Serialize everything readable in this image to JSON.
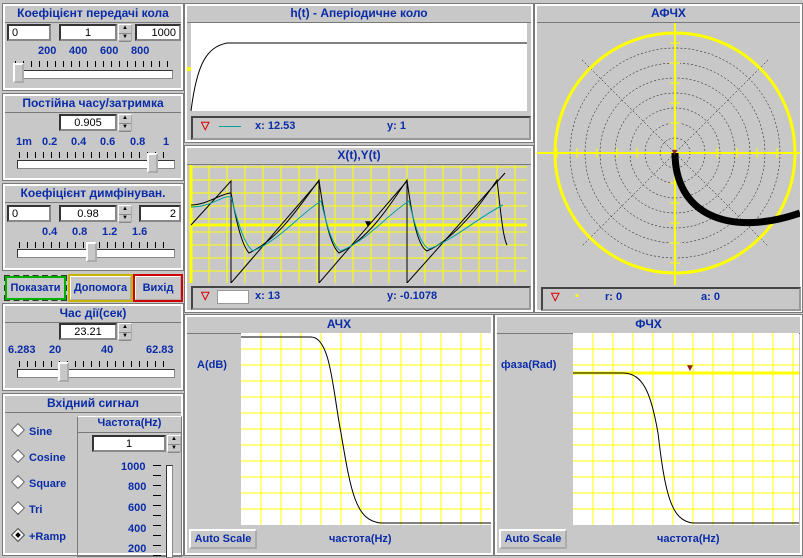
{
  "gain": {
    "title": "Коефіцієнт передачі кола",
    "min": "0",
    "value": "1",
    "max": "1000",
    "ticks": [
      "200",
      "400",
      "600",
      "800"
    ]
  },
  "timeconst": {
    "title": "Постійна часу/затримка",
    "value": "0.905",
    "ticks": [
      "1m",
      "0.2",
      "0.4",
      "0.6",
      "0.8",
      "1"
    ]
  },
  "diffcoef": {
    "title": "Коефіцієнт димфінуван.",
    "min": "0",
    "value": "0.98",
    "max": "2",
    "ticks": [
      "0.4",
      "0.8",
      "1.2",
      "1.6"
    ]
  },
  "buttons": {
    "show": "Показати",
    "help": "Допомога",
    "exit": "Вихід"
  },
  "duration": {
    "title": "Час дії(сек)",
    "value": "23.21",
    "ticks": [
      "6.283",
      "20",
      "40",
      "62.83"
    ]
  },
  "input": {
    "title": "Вхідний сигнал",
    "options": [
      "Sine",
      "Cosine",
      "Square",
      "Tri",
      "+Ramp"
    ],
    "selected": "+Ramp",
    "freq_title": "Частота(Hz)",
    "freq_value": "1",
    "freq_ticks": [
      "1000",
      "800",
      "600",
      "400",
      "200"
    ]
  },
  "ht": {
    "title": "h(t) - Аперіодичне коло",
    "x": "x: 12.53",
    "y": "y: 1"
  },
  "xt": {
    "title": "X(t),Y(t)",
    "x": "x: 13",
    "y": "y: -0.1078"
  },
  "afch": {
    "title": "АФЧХ",
    "r": "r: 0",
    "a": "a: 0"
  },
  "ach": {
    "title": "АЧХ",
    "ylabel": "A(dB)",
    "xlabel": "частота(Hz)",
    "autoscale": "Auto Scale"
  },
  "fch": {
    "title": "ФЧХ",
    "ylabel": "фаза(Rad)",
    "xlabel": "частота(Hz)",
    "autoscale": "Auto Scale"
  },
  "colors": {
    "grid": "#ffff00",
    "plot_bg": "#ffffff",
    "label": "#0a2ca8",
    "trace": "#000000"
  }
}
